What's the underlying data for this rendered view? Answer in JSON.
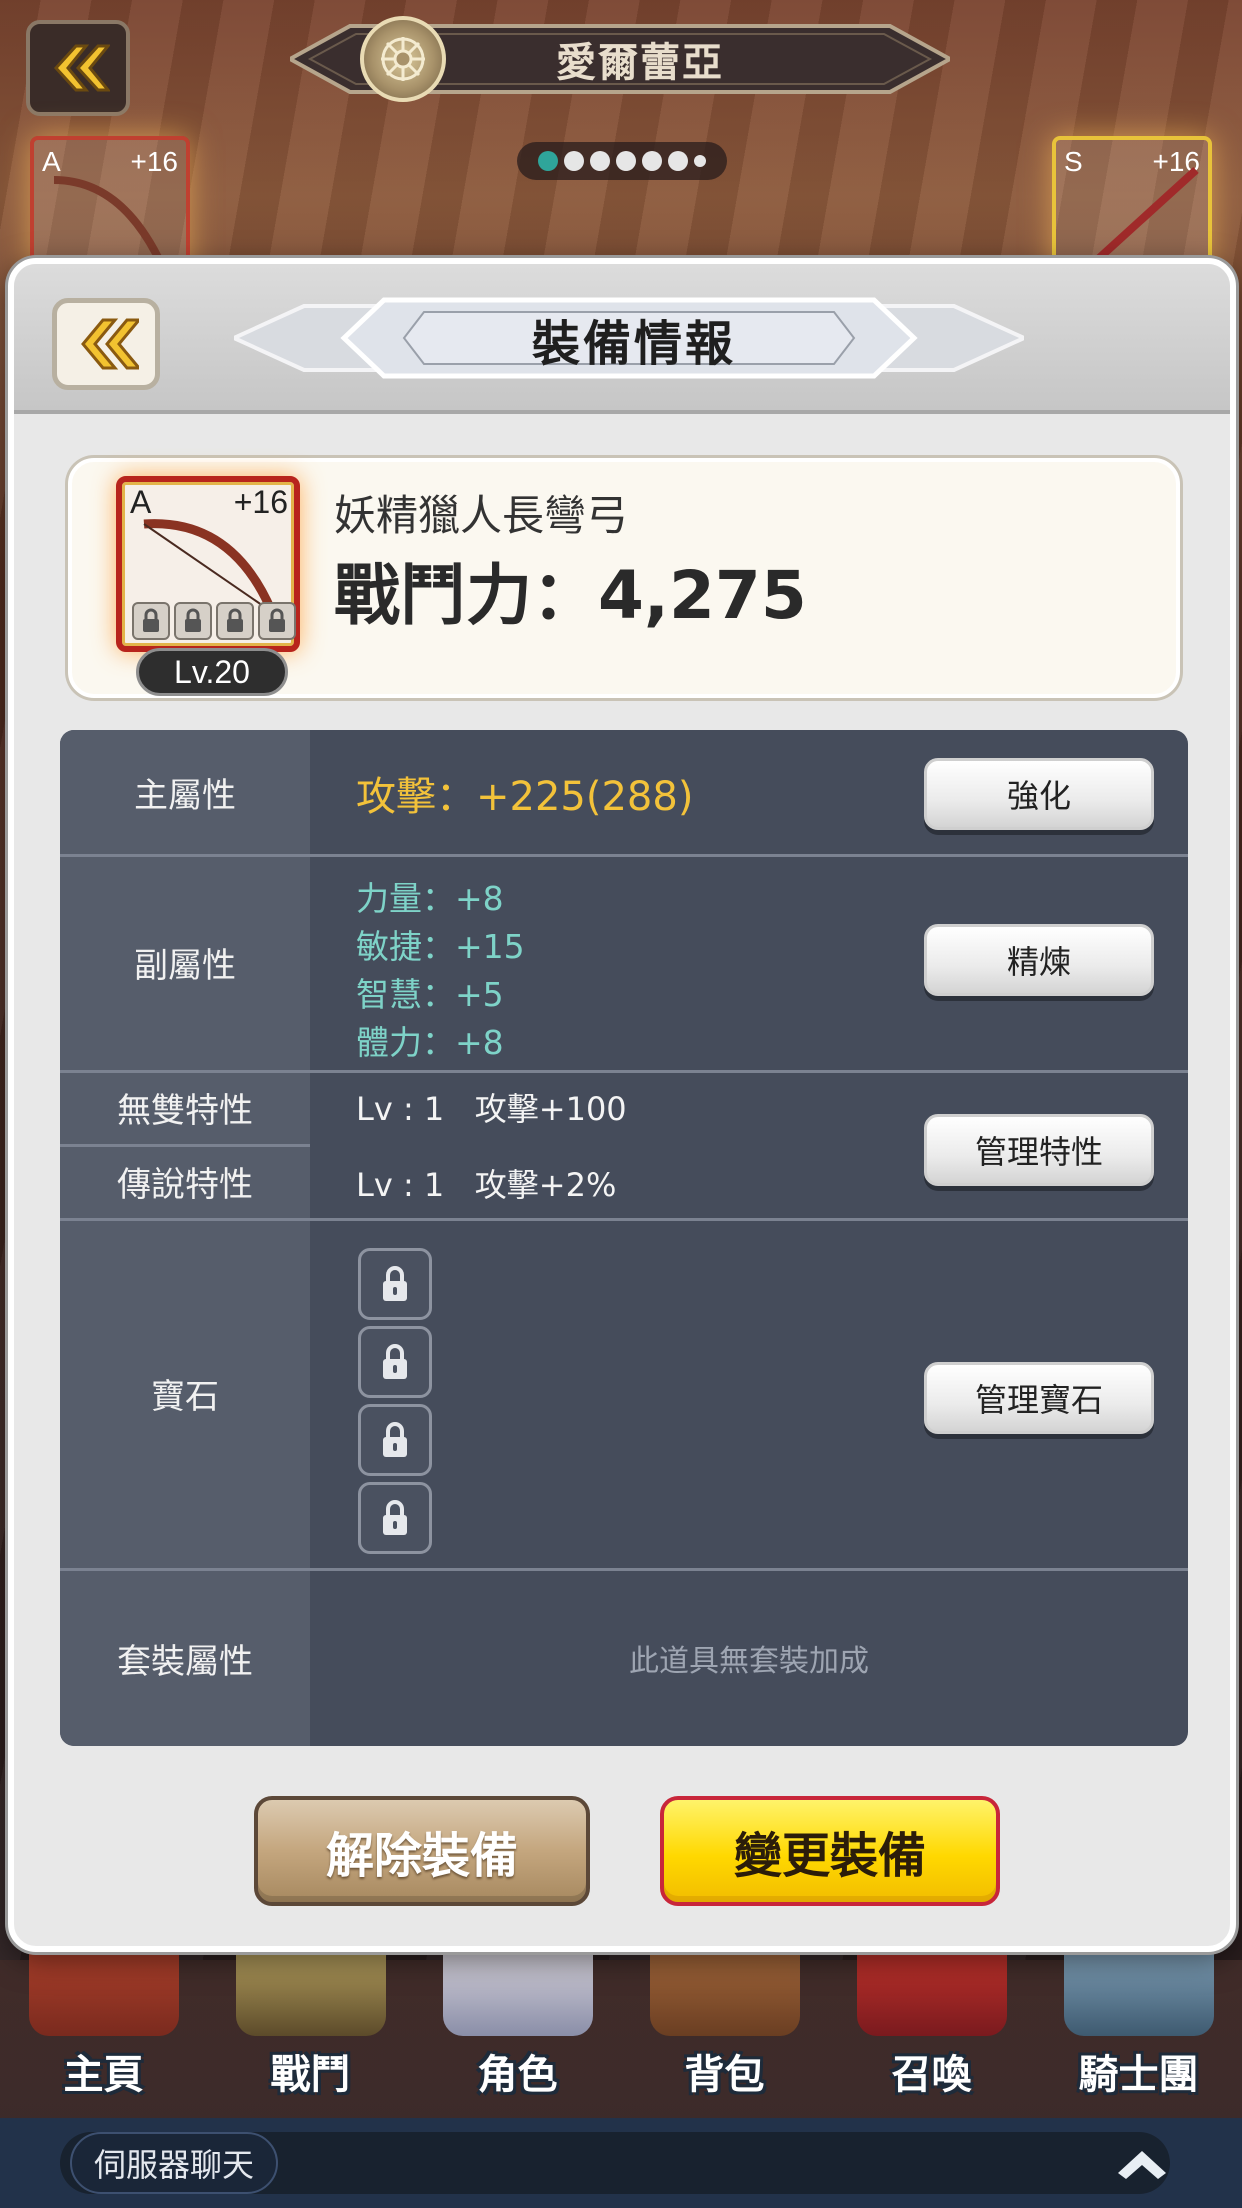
{
  "top_bar": {
    "title": "愛爾蕾亞",
    "page_dots": 7,
    "active_dot": 0
  },
  "background_items": [
    {
      "grade": "A",
      "plus": "+16"
    },
    {
      "grade": "S",
      "plus": "+16"
    }
  ],
  "dialog": {
    "title": "裝備情報",
    "item": {
      "grade": "A",
      "plus": "+16",
      "level": "Lv.20",
      "name": "妖精獵人長彎弓",
      "power": "戰鬥力：4,275"
    },
    "stats": {
      "main_label": "主屬性",
      "main_value": "攻擊：+225(288)",
      "main_button": "強化",
      "sub_label": "副屬性",
      "sub_values": [
        "力量：+8",
        "敏捷：+15",
        "智慧：+5",
        "體力：+8"
      ],
      "sub_button": "精煉",
      "unique_label": "無雙特性",
      "unique_value": "Lv : 1   攻擊+100",
      "legend_label": "傳說特性",
      "legend_value": "Lv : 1   攻擊+2%",
      "trait_button": "管理特性",
      "gem_label": "寶石",
      "gem_slots": 4,
      "gem_button": "管理寶石",
      "set_label": "套裝屬性",
      "set_value": "此道具無套裝加成"
    },
    "unequip_button": "解除裝備",
    "change_button": "變更裝備"
  },
  "bottom_nav": [
    {
      "label": "主頁",
      "icon": "house-icon"
    },
    {
      "label": "戰鬥",
      "icon": "crossed-swords-icon"
    },
    {
      "label": "角色",
      "icon": "character-icon"
    },
    {
      "label": "背包",
      "icon": "backpack-icon"
    },
    {
      "label": "召喚",
      "icon": "summon-orb-icon"
    },
    {
      "label": "騎士團",
      "icon": "castle-icon"
    }
  ],
  "chat": {
    "label": "伺服器聊天"
  },
  "colors": {
    "main_stat": "#f3c23a",
    "sub_stat": "#7ed3c8",
    "change_button": "#ffd800",
    "active_dot": "#2fa59a"
  }
}
